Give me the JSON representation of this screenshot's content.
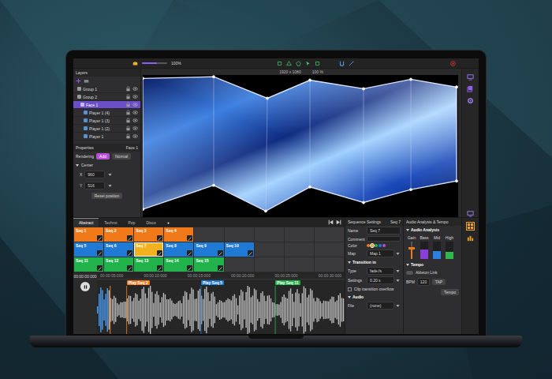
{
  "toolbar": {
    "zoom": "100%",
    "resolution": "1920 x 1080",
    "scale": "100 %"
  },
  "layers": {
    "title": "Layers",
    "items": [
      {
        "label": "Group 1",
        "kind": "group",
        "selected": false
      },
      {
        "label": "Group 2",
        "kind": "group",
        "selected": false
      },
      {
        "label": "Face 1",
        "kind": "face",
        "selected": true
      },
      {
        "label": "Player 1 (4)",
        "kind": "player",
        "selected": false
      },
      {
        "label": "Player 1 (3)",
        "kind": "player",
        "selected": false
      },
      {
        "label": "Player 1 (2)",
        "kind": "player",
        "selected": false
      },
      {
        "label": "Player 1",
        "kind": "player",
        "selected": false
      }
    ]
  },
  "properties": {
    "title": "Properties",
    "target": "Face 1",
    "rendering": "Rendering",
    "modes": [
      {
        "label": "Add",
        "selected": true
      },
      {
        "label": "Normal",
        "selected": false
      }
    ],
    "section": "Center",
    "fields": [
      {
        "label": "X",
        "value": "960"
      },
      {
        "label": "Y",
        "value": "516"
      }
    ],
    "reset": "Reset position"
  },
  "sequence_tabs": [
    {
      "label": "Abstract",
      "selected": true
    },
    {
      "label": "Techno",
      "selected": false
    },
    {
      "label": "Pop",
      "selected": false
    },
    {
      "label": "Disco",
      "selected": false
    }
  ],
  "add_tab": "+",
  "sequences": [
    [
      {
        "label": "Seq 1",
        "color": "#f07a1a",
        "selected": false
      },
      {
        "label": "Seq 2",
        "color": "#f07a1a",
        "selected": false
      },
      {
        "label": "Seq 3",
        "color": "#f07a1a",
        "selected": false
      },
      {
        "label": "Seq 4",
        "color": "#f07a1a",
        "selected": false
      }
    ],
    [
      {
        "label": "Seq 5",
        "color": "#1f7ad6",
        "selected": false
      },
      {
        "label": "Seq 6",
        "color": "#1f7ad6",
        "selected": false
      },
      {
        "label": "Seq 7",
        "color": "#f2b21f",
        "selected": true
      },
      {
        "label": "Seq 8",
        "color": "#1f7ad6",
        "selected": false
      },
      {
        "label": "Seq 9",
        "color": "#1f7ad6",
        "selected": false
      },
      {
        "label": "Seq 10",
        "color": "#1f7ad6",
        "selected": false
      }
    ],
    [
      {
        "label": "Seq 11",
        "color": "#22b24c",
        "selected": false
      },
      {
        "label": "Seq 12",
        "color": "#22b24c",
        "selected": false
      },
      {
        "label": "Seq 13",
        "color": "#22b24c",
        "selected": false
      },
      {
        "label": "Seq 14",
        "color": "#22b24c",
        "selected": false
      },
      {
        "label": "Seq 15",
        "color": "#22b24c",
        "selected": false
      }
    ]
  ],
  "timeline": {
    "time": "00:00:00:000",
    "ticks": [
      "00:00:05:000",
      "00:00:10:000",
      "00:00:15:000",
      "00:00:20:000",
      "00:00:25:000",
      "00:00:30:000"
    ],
    "markers": [
      {
        "label": "Play Seq 2",
        "color": "#f07a1a"
      },
      {
        "label": "Play Seq 5",
        "color": "#1f7ad6"
      },
      {
        "label": "Play Seq 11",
        "color": "#22b24c"
      }
    ]
  },
  "sequence_settings": {
    "title": "Sequence Settings",
    "current": "Seq 7",
    "fields": [
      {
        "label": "Name",
        "value": "Seq 7",
        "kind": "text"
      },
      {
        "label": "Comment",
        "value": "",
        "kind": "text"
      },
      {
        "label": "Map",
        "value": "Map 1",
        "kind": "select"
      }
    ],
    "color_label": "Color",
    "swatches": [
      {
        "color": "#f07a1a",
        "selected": false
      },
      {
        "color": "#f2b21f",
        "selected": true
      },
      {
        "color": "#22b24c",
        "selected": false
      },
      {
        "color": "#1f7ad6",
        "selected": false
      },
      {
        "color": "#b44fd6",
        "selected": false
      }
    ],
    "transition_title": "Transition in",
    "transition_fields": [
      {
        "label": "Type",
        "value": "fade.fs",
        "kind": "select"
      },
      {
        "label": "Settings",
        "value": "0.20 s",
        "kind": "select"
      }
    ],
    "overflow": {
      "label": "Clip transition overflow",
      "checked": false
    },
    "audio_title": "Audio",
    "audio_fields": [
      {
        "label": "File",
        "value": "(none)",
        "kind": "select"
      }
    ]
  },
  "audio_analysis": {
    "title": "Audio Analysis & Tempo",
    "subtitle": "Audio Analysis",
    "bands": [
      {
        "label": "Gain",
        "level": 0.6,
        "kind": "slider",
        "color": "#f07a1a"
      },
      {
        "label": "Bass",
        "level": 0.55,
        "kind": "bar",
        "color": "#8b3fd9"
      },
      {
        "label": "Mid",
        "level": 0.45,
        "kind": "bar",
        "color": "#2b7fe0"
      },
      {
        "label": "High",
        "level": 0.4,
        "kind": "bar",
        "color": "#2fb84a"
      }
    ],
    "tempo": {
      "title": "Tempo",
      "link": {
        "label": "Ableton Link",
        "on": false
      },
      "bpm_label": "BPM",
      "bpm": "120",
      "tap": "TAP",
      "reset": "Tempo"
    }
  }
}
